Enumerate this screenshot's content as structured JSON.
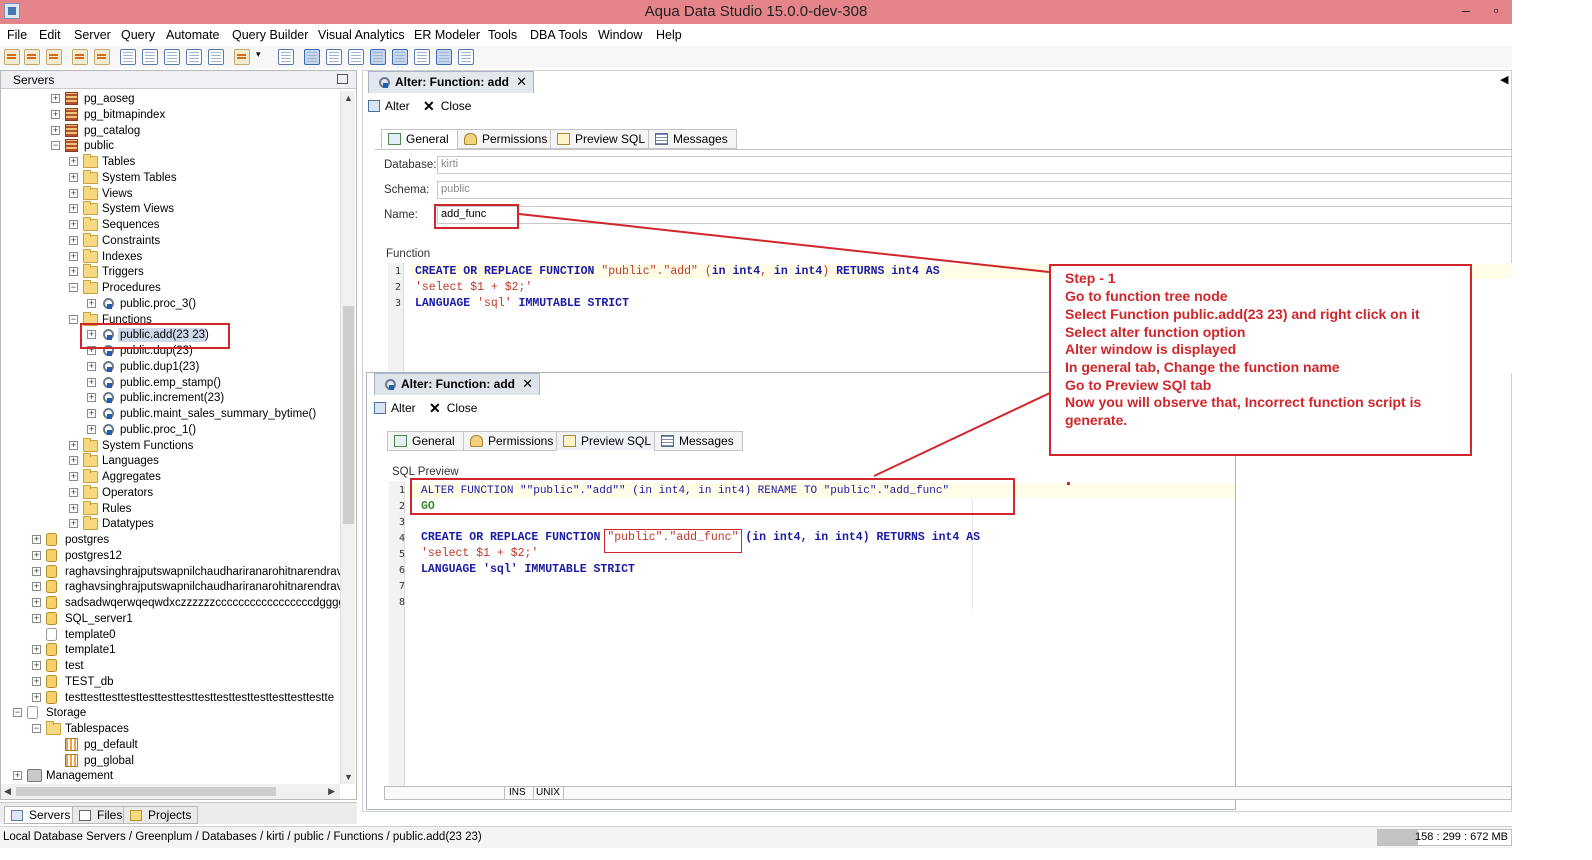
{
  "window": {
    "title": "Aqua Data Studio 15.0.0-dev-308"
  },
  "menu": [
    "File",
    "Edit",
    "Server",
    "Query",
    "Automate",
    "Query Builder",
    "Visual Analytics",
    "ER Modeler",
    "Tools",
    "DBA Tools",
    "Window",
    "Help"
  ],
  "left_panel": {
    "header": "Servers",
    "tree": [
      {
        "label": "pg_aoseg",
        "icon": "schema-icon"
      },
      {
        "label": "pg_bitmapindex",
        "icon": "schema-icon"
      },
      {
        "label": "pg_catalog",
        "icon": "schema-icon"
      },
      {
        "label": "public",
        "icon": "schema-icon"
      },
      {
        "label": "Tables",
        "icon": "folder-icon"
      },
      {
        "label": "System Tables",
        "icon": "folder-icon"
      },
      {
        "label": "Views",
        "icon": "folder-icon"
      },
      {
        "label": "System Views",
        "icon": "folder-icon"
      },
      {
        "label": "Sequences",
        "icon": "folder-icon"
      },
      {
        "label": "Constraints",
        "icon": "folder-icon"
      },
      {
        "label": "Indexes",
        "icon": "folder-icon"
      },
      {
        "label": "Triggers",
        "icon": "folder-icon"
      },
      {
        "label": "Procedures",
        "icon": "folder-icon"
      },
      {
        "label": "public.proc_3()",
        "icon": "function-icon"
      },
      {
        "label": "Functions",
        "icon": "folder-icon"
      },
      {
        "label": "public.add(23 23)",
        "icon": "function-icon"
      },
      {
        "label": "public.dup(23)",
        "icon": "function-icon"
      },
      {
        "label": "public.dup1(23)",
        "icon": "function-icon"
      },
      {
        "label": "public.emp_stamp()",
        "icon": "function-icon"
      },
      {
        "label": "public.increment(23)",
        "icon": "function-icon"
      },
      {
        "label": "public.maint_sales_summary_bytime()",
        "icon": "function-icon"
      },
      {
        "label": "public.proc_1()",
        "icon": "function-icon"
      },
      {
        "label": "System Functions",
        "icon": "folder-icon"
      },
      {
        "label": "Languages",
        "icon": "folder-icon"
      },
      {
        "label": "Aggregates",
        "icon": "folder-icon"
      },
      {
        "label": "Operators",
        "icon": "folder-icon"
      },
      {
        "label": "Rules",
        "icon": "folder-icon"
      },
      {
        "label": "Datatypes",
        "icon": "folder-icon"
      },
      {
        "label": "postgres",
        "icon": "database-icon"
      },
      {
        "label": "postgres12",
        "icon": "database-icon"
      },
      {
        "label": "raghavsinghrajputswapnilchaudhariranarohitnarendravats",
        "icon": "database-icon"
      },
      {
        "label": "raghavsinghrajputswapnilchaudhariranarohitnarendravats",
        "icon": "database-icon"
      },
      {
        "label": "sadsadwqerwqeqwdxczzzzzzcccccccccccccccccdgggggggghk",
        "icon": "database-icon"
      },
      {
        "label": "SQL_server1",
        "icon": "database-icon"
      },
      {
        "label": "template0",
        "icon": "database-icon"
      },
      {
        "label": "template1",
        "icon": "database-icon"
      },
      {
        "label": "test",
        "icon": "database-icon"
      },
      {
        "label": "TEST_db",
        "icon": "database-icon"
      },
      {
        "label": "testtesttesttesttesttesttesttesttesttesttesttesttesttestte",
        "icon": "database-icon"
      },
      {
        "label": "Storage",
        "icon": "storage-icon"
      },
      {
        "label": "Tablespaces",
        "icon": "folder-icon"
      },
      {
        "label": "pg_default",
        "icon": "tablespace-icon"
      },
      {
        "label": "pg_global",
        "icon": "tablespace-icon"
      },
      {
        "label": "Management",
        "icon": "management-icon"
      }
    ],
    "bottom_tabs": [
      "Servers",
      "Files",
      "Projects"
    ]
  },
  "editor1": {
    "tab_title": "Alter: Function: add",
    "actions": {
      "alter": "Alter",
      "close": "Close"
    },
    "subtabs": [
      "General",
      "Permissions",
      "Preview SQL",
      "Messages"
    ],
    "active_subtab": "General",
    "fields": {
      "database_label": "Database:",
      "database_value": "kirti",
      "schema_label": "Schema:",
      "schema_value": "public",
      "name_label": "Name:",
      "name_value": "add_func"
    },
    "function_label": "Function",
    "code_lines": [
      "CREATE OR REPLACE FUNCTION \"public\".\"add\" (in int4, in int4) RETURNS int4 AS",
      "'select $1 + $2;'",
      "LANGUAGE 'sql' IMMUTABLE STRICT"
    ]
  },
  "editor2": {
    "tab_title": "Alter: Function: add",
    "actions": {
      "alter": "Alter",
      "close": "Close"
    },
    "subtabs": [
      "General",
      "Permissions",
      "Preview SQL",
      "Messages"
    ],
    "active_subtab": "Preview SQL",
    "preview_label": "SQL Preview",
    "line_numbers": [
      "1",
      "2",
      "3",
      "4",
      "5",
      "6",
      "7",
      "8"
    ],
    "sql": {
      "line1": "ALTER FUNCTION \"\"public\".\"add\"\" (in int4, in int4) RENAME TO \"public\".\"add_func\"",
      "line2": "GO",
      "line4_a": "CREATE OR REPLACE FUNCTION ",
      "line4_b": "\"public\".\"add_func\"",
      "line4_c": " (in int4, in int4) RETURNS int4 AS",
      "line5": "'select $1 + $2;'",
      "line6": "LANGUAGE 'sql' IMMUTABLE STRICT"
    },
    "status": {
      "ins": "INS",
      "unix": "UNIX"
    }
  },
  "annotation": {
    "lines": [
      "Step - 1",
      "Go to function tree node",
      "Select Function public.add(23 23) and right click on it",
      "Select alter function option",
      "Alter window is displayed",
      "In general tab, Change the function name",
      "Go to Preview SQl tab",
      "Now you will observe that, Incorrect function script is",
      "generate."
    ]
  },
  "statusbar": {
    "path": "Local Database Servers / Greenplum / Databases / kirti / public / Functions / public.add(23 23)",
    "memory": "158 : 299 : 672 MB",
    "memory_fraction": 0.3
  },
  "colors": {
    "titlebar": "#e5858a",
    "annotation_red": "#d0262c",
    "keyword_blue": "#1a1aa6",
    "string_red": "#c0392b"
  }
}
